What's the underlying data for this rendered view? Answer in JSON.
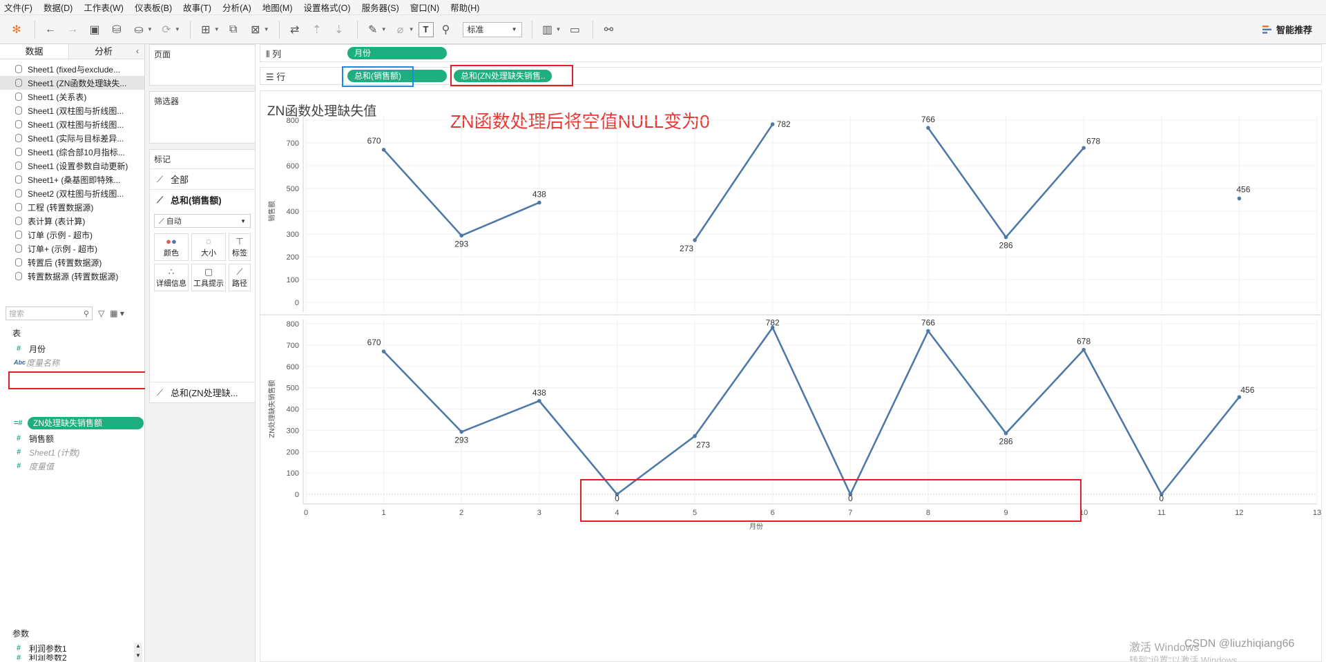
{
  "menu": [
    "文件(F)",
    "数据(D)",
    "工作表(W)",
    "仪表板(B)",
    "故事(T)",
    "分析(A)",
    "地图(M)",
    "设置格式(O)",
    "服务器(S)",
    "窗口(N)",
    "帮助(H)"
  ],
  "toolbar": {
    "fit_select": "标准",
    "smart_recommend": "智能推荐",
    "text_button": "T"
  },
  "datapane": {
    "tabs": [
      "数据",
      "分析"
    ],
    "datasources": [
      "Sheet1 (fixed与exclude...",
      "Sheet1 (ZN函数处理缺失...",
      "Sheet1 (关系表)",
      "Sheet1 (双柱图与折线图...",
      "Sheet1 (双柱图与折线图...",
      "Sheet1 (实际与目标差异...",
      "Sheet1 (综合部10月指标...",
      "Sheet1 (设置参数自动更新)",
      "Sheet1+ (桑基图即特殊...",
      "Sheet2 (双柱图与折线图...",
      "工程 (转置数据源)",
      "表计算 (表计算)",
      "订单 (示例 - 超市)",
      "订单+ (示例 - 超市)",
      "转置后 (转置数据源)",
      "转置数据源 (转置数据源)"
    ],
    "selected_index": 1,
    "search_placeholder": "搜索",
    "table_section": "表",
    "fields": [
      {
        "icon": "#",
        "label": "月份",
        "italic": false
      },
      {
        "icon": "Abc",
        "label": "度量名称",
        "italic": true
      },
      {
        "icon": "=#",
        "label": "ZN处理缺失销售额",
        "italic": false
      },
      {
        "icon": "#",
        "label": "销售额",
        "italic": false
      },
      {
        "icon": "#",
        "label": "Sheet1 (计数)",
        "italic": true
      },
      {
        "icon": "#",
        "label": "度量值",
        "italic": true
      }
    ],
    "param_section": "参数",
    "params": [
      "利润参数1",
      "利润参数2"
    ]
  },
  "cards": {
    "pages": "页面",
    "filters": "筛选器",
    "marks": "标记",
    "marks_all": "全部",
    "marks_sales": "总和(销售额)",
    "marks_type": "自动",
    "mark_buttons": [
      "颜色",
      "大小",
      "标签",
      "详细信息",
      "工具提示",
      "路径"
    ],
    "marks_zn": "总和(ZN处理缺..."
  },
  "shelves": {
    "columns_label": "列",
    "rows_label": "行",
    "columns_pill": "月份",
    "rows_pill_1": "总和(销售额)",
    "rows_pill_2": "总和(ZN处理缺失销售.."
  },
  "view": {
    "title": "ZN函数处理缺失值",
    "annotation": "ZN函数处理后将空值NULL变为0",
    "watermark": "激活 Windows",
    "watermark2": "转到\"设置\"以激活 Windows。",
    "csdn": "CSDN @liuzhiqiang66"
  },
  "colors": {
    "line": "#4e79a7",
    "pill": "#1fae80",
    "annotation": "#e53935"
  },
  "chart_data": [
    {
      "type": "line",
      "ylabel": "销售额",
      "xlim": [
        0,
        13
      ],
      "ylim": [
        0,
        800
      ],
      "yticks": [
        0,
        100,
        200,
        300,
        400,
        500,
        600,
        700,
        800
      ],
      "x": [
        1,
        2,
        3,
        4,
        5,
        6,
        7,
        8,
        9,
        10,
        11,
        12
      ],
      "values": [
        670,
        293,
        438,
        null,
        273,
        782,
        null,
        766,
        286,
        678,
        null,
        456
      ],
      "labels": [
        "670",
        "293",
        "438",
        "",
        "273",
        "782",
        "",
        "766",
        "286",
        "678",
        "",
        "456"
      ]
    },
    {
      "type": "line",
      "ylabel": "ZN处理缺失销售额",
      "xlabel": "月份",
      "xlim": [
        0,
        13
      ],
      "ylim": [
        0,
        800
      ],
      "yticks": [
        0,
        100,
        200,
        300,
        400,
        500,
        600,
        700,
        800
      ],
      "xticks": [
        0,
        1,
        2,
        3,
        4,
        5,
        6,
        7,
        8,
        9,
        10,
        11,
        12,
        13
      ],
      "x": [
        1,
        2,
        3,
        4,
        5,
        6,
        7,
        8,
        9,
        10,
        11,
        12
      ],
      "values": [
        670,
        293,
        438,
        0,
        273,
        782,
        0,
        766,
        286,
        678,
        0,
        456
      ],
      "labels": [
        "670",
        "293",
        "438",
        "0",
        "273",
        "782",
        "0",
        "766",
        "286",
        "678",
        "0",
        "456"
      ]
    }
  ]
}
